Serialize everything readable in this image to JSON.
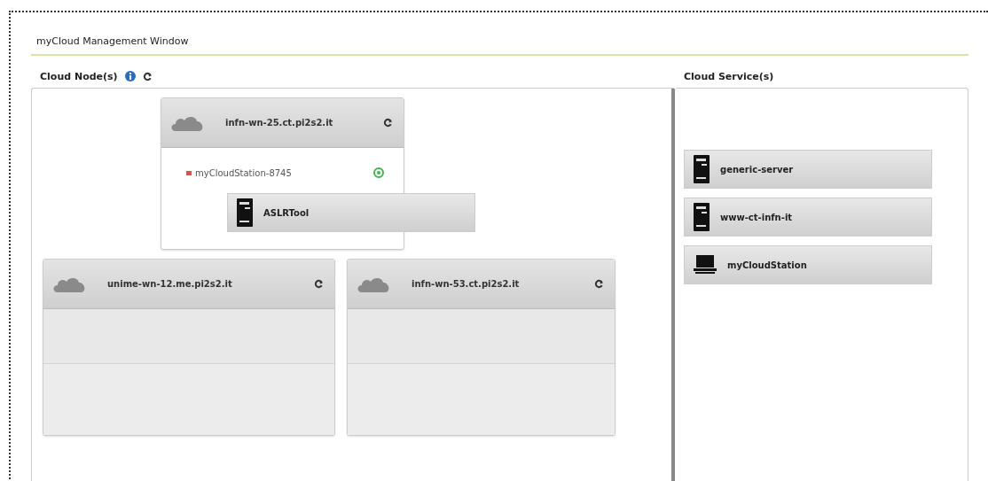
{
  "window": {
    "title": "myCloud Management Window"
  },
  "nodes_panel": {
    "title": "Cloud Node(s)",
    "nodes": [
      {
        "name": "infn-wn-25.ct.pi2s2.it",
        "instances": [
          {
            "name": "myCloudStation-8745",
            "active": true
          }
        ]
      },
      {
        "name": "unime-wn-12.me.pi2s2.it"
      },
      {
        "name": "infn-wn-53.ct.pi2s2.it"
      }
    ],
    "dragged_service": {
      "name": "ASLRTool",
      "kind": "server"
    }
  },
  "services_panel": {
    "title": "Cloud Service(s)",
    "services": [
      {
        "name": "generic-server",
        "kind": "server"
      },
      {
        "name": "www-ct-infn-it",
        "kind": "server"
      },
      {
        "name": "myCloudStation",
        "kind": "workstation"
      }
    ]
  }
}
